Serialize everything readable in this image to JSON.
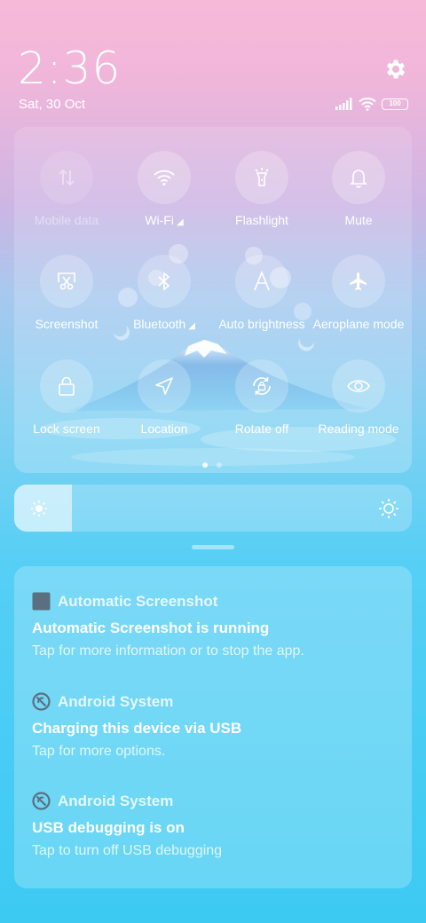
{
  "status": {
    "time": "2:36",
    "date": "Sat, 30 Oct",
    "battery": "100"
  },
  "quick_settings": {
    "tiles": [
      {
        "label": "Mobile data",
        "icon": "mobile-data-icon",
        "active": false
      },
      {
        "label": "Wi-Fi",
        "icon": "wifi-icon",
        "active": true
      },
      {
        "label": "Flashlight",
        "icon": "flashlight-icon",
        "active": true
      },
      {
        "label": "Mute",
        "icon": "bell-icon",
        "active": true
      },
      {
        "label": "Screenshot",
        "icon": "screenshot-scissors-icon",
        "active": true
      },
      {
        "label": "Bluetooth",
        "icon": "bluetooth-icon",
        "active": true
      },
      {
        "label": "Auto brightness",
        "icon": "auto-brightness-icon",
        "active": true
      },
      {
        "label": "Aeroplane mode",
        "icon": "airplane-icon",
        "active": true
      },
      {
        "label": "Lock screen",
        "icon": "lock-icon",
        "active": true
      },
      {
        "label": "Location",
        "icon": "location-icon",
        "active": true
      },
      {
        "label": "Rotate off",
        "icon": "rotate-lock-icon",
        "active": true
      },
      {
        "label": "Reading mode",
        "icon": "eye-icon",
        "active": true
      }
    ],
    "page_count": 2,
    "current_page": 1
  },
  "brightness": {
    "level": 0.145
  },
  "notifications": [
    {
      "app": "Automatic Screenshot",
      "app_icon": "app-square-icon",
      "title": "Automatic Screenshot is running",
      "body": "Tap for more information or to stop the app."
    },
    {
      "app": "Android System",
      "app_icon": "android-system-icon",
      "title": "Charging this device via USB",
      "body": "Tap for more options."
    },
    {
      "app": "Android System",
      "app_icon": "android-system-icon",
      "title": "USB debugging is on",
      "body": "Tap to turn off USB debugging"
    }
  ],
  "colors": {
    "accent_white": "#ffffff",
    "icon_gray": "#5a6f80"
  }
}
